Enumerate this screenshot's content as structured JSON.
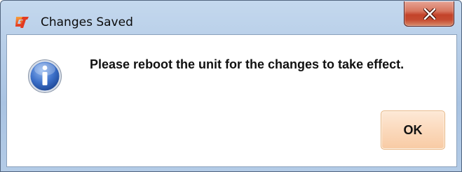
{
  "window": {
    "title": "Changes Saved"
  },
  "dialog": {
    "message": "Please reboot the unit for the changes to take effect.",
    "ok_label": "OK"
  },
  "icons": {
    "app": "app-logo-icon",
    "close": "close-icon",
    "info": "info-icon"
  },
  "colors": {
    "close_button": "#c3432a",
    "ok_button": "#fbd9bc",
    "info_icon": "#2d5fb8",
    "app_logo": "#e8402a"
  }
}
